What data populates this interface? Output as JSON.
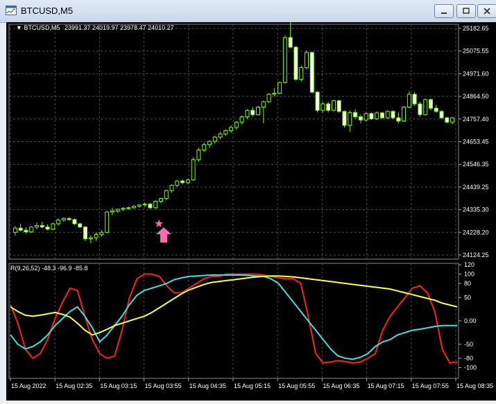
{
  "window": {
    "title": "BTCUSD,M5"
  },
  "info_line": {
    "symbol": "BTCUSD,M5",
    "ohlc": "23991.37 24019.97 23978.47 24010.27"
  },
  "price_axis": [
    "25182.65",
    "25075.55",
    "24971.60",
    "24864.50",
    "24757.40",
    "24653.45",
    "24546.35",
    "24439.25",
    "24335.30",
    "24228.20",
    "24124.25"
  ],
  "indicator": {
    "label": "R(9,26,52) -48.3 -96.9 -85.8",
    "axis": [
      "120",
      "100",
      "80",
      "50",
      "0.00",
      "-50",
      "-80",
      "-100"
    ]
  },
  "time_axis": [
    "15 Aug 2022",
    "15 Aug 02:35",
    "15 Aug 03:15",
    "15 Aug 03:55",
    "15 Aug 04:35",
    "15 Aug 05:15",
    "15 Aug 05:55",
    "15 Aug 06:35",
    "15 Aug 07:15",
    "15 Aug 07:55",
    "15 Aug 08:35"
  ],
  "colors": {
    "background": "#000000",
    "candle": "#7CFC00",
    "bull_body": "#000000",
    "bear_body": "#ffffff",
    "grid": "#4d4d4d",
    "arrow": "#ff69b4",
    "line_fast": "#ff2020",
    "line_mid": "#40e0e0",
    "line_slow": "#ffff40",
    "axis_text": "#ffffff"
  },
  "markers": {
    "star_icon": "star-icon",
    "arrow_icon": "up-arrow-icon"
  },
  "chart_data": {
    "type": "candlestick",
    "series": [
      {
        "name": "BTCUSD,M5",
        "ohlc": [
          [
            24230,
            24260,
            24215,
            24250
          ],
          [
            24250,
            24270,
            24235,
            24240
          ],
          [
            24240,
            24255,
            24225,
            24232
          ],
          [
            24232,
            24258,
            24228,
            24255
          ],
          [
            24255,
            24275,
            24245,
            24262
          ],
          [
            24262,
            24280,
            24250,
            24255
          ],
          [
            24255,
            24268,
            24240,
            24245
          ],
          [
            24245,
            24275,
            24240,
            24270
          ],
          [
            24270,
            24295,
            24262,
            24288
          ],
          [
            24288,
            24300,
            24280,
            24295
          ],
          [
            24295,
            24300,
            24285,
            24290
          ],
          [
            24290,
            24295,
            24265,
            24270
          ],
          [
            24270,
            24275,
            24250,
            24255
          ],
          [
            24255,
            24260,
            24190,
            24200
          ],
          [
            24200,
            24215,
            24180,
            24205
          ],
          [
            24205,
            24230,
            24190,
            24220
          ],
          [
            24220,
            24240,
            24210,
            24230
          ],
          [
            24230,
            24330,
            24225,
            24325
          ],
          [
            24325,
            24345,
            24310,
            24330
          ],
          [
            24330,
            24342,
            24322,
            24338
          ],
          [
            24338,
            24348,
            24330,
            24342
          ],
          [
            24342,
            24350,
            24335,
            24345
          ],
          [
            24345,
            24358,
            24340,
            24352
          ],
          [
            24352,
            24362,
            24345,
            24358
          ],
          [
            24358,
            24370,
            24350,
            24362
          ],
          [
            24362,
            24368,
            24340,
            24345
          ],
          [
            24345,
            24380,
            24340,
            24375
          ],
          [
            24375,
            24392,
            24365,
            24388
          ],
          [
            24388,
            24430,
            24380,
            24425
          ],
          [
            24425,
            24455,
            24415,
            24450
          ],
          [
            24450,
            24475,
            24440,
            24470
          ],
          [
            24470,
            24478,
            24455,
            24462
          ],
          [
            24462,
            24480,
            24455,
            24475
          ],
          [
            24475,
            24580,
            24470,
            24570
          ],
          [
            24570,
            24625,
            24560,
            24615
          ],
          [
            24615,
            24650,
            24605,
            24640
          ],
          [
            24640,
            24660,
            24625,
            24655
          ],
          [
            24655,
            24682,
            24645,
            24675
          ],
          [
            24675,
            24700,
            24665,
            24690
          ],
          [
            24690,
            24712,
            24680,
            24705
          ],
          [
            24705,
            24730,
            24695,
            24720
          ],
          [
            24720,
            24750,
            24710,
            24745
          ],
          [
            24745,
            24775,
            24735,
            24770
          ],
          [
            24770,
            24805,
            24760,
            24800
          ],
          [
            24800,
            24815,
            24770,
            24780
          ],
          [
            24780,
            24820,
            24775,
            24815
          ],
          [
            24815,
            24845,
            24740,
            24840
          ],
          [
            24840,
            24880,
            24835,
            24875
          ],
          [
            24875,
            24905,
            24865,
            24880
          ],
          [
            24880,
            24935,
            24875,
            24930
          ],
          [
            24930,
            25150,
            24925,
            25140
          ],
          [
            25140,
            25210,
            25090,
            25095
          ],
          [
            25095,
            25100,
            24940,
            24945
          ],
          [
            24945,
            25010,
            24935,
            25000
          ],
          [
            25000,
            25080,
            24990,
            25070
          ],
          [
            25070,
            25075,
            24880,
            24885
          ],
          [
            24885,
            24890,
            24790,
            24800
          ],
          [
            24800,
            24840,
            24790,
            24830
          ],
          [
            24830,
            24840,
            24790,
            24800
          ],
          [
            24800,
            24850,
            24795,
            24845
          ],
          [
            24845,
            24850,
            24790,
            24795
          ],
          [
            24795,
            24800,
            24720,
            24730
          ],
          [
            24730,
            24800,
            24700,
            24790
          ],
          [
            24790,
            24805,
            24760,
            24770
          ],
          [
            24770,
            24780,
            24740,
            24755
          ],
          [
            24755,
            24790,
            24748,
            24785
          ],
          [
            24785,
            24790,
            24755,
            24760
          ],
          [
            24760,
            24795,
            24755,
            24788
          ],
          [
            24788,
            24792,
            24760,
            24765
          ],
          [
            24765,
            24800,
            24760,
            24795
          ],
          [
            24795,
            24800,
            24760,
            24765
          ],
          [
            24765,
            24790,
            24740,
            24750
          ],
          [
            24750,
            24820,
            24745,
            24815
          ],
          [
            24815,
            24890,
            24810,
            24875
          ],
          [
            24875,
            24885,
            24820,
            24830
          ],
          [
            24830,
            24840,
            24770,
            24780
          ],
          [
            24780,
            24855,
            24775,
            24850
          ],
          [
            24850,
            24855,
            24800,
            24810
          ],
          [
            24810,
            24825,
            24790,
            24795
          ],
          [
            24795,
            24800,
            24760,
            24765
          ],
          [
            24765,
            24770,
            24740,
            24745
          ],
          [
            24745,
            24770,
            24735,
            24765
          ]
        ]
      }
    ],
    "price_range": [
      24124.25,
      25182.65
    ],
    "indicator_range": [
      -120,
      120
    ],
    "indicator_series": [
      {
        "name": "fast",
        "values": [
          35,
          -5,
          -60,
          -80,
          -70,
          -40,
          5,
          40,
          70,
          65,
          10,
          -40,
          -70,
          -80,
          -75,
          -20,
          50,
          90,
          100,
          100,
          95,
          75,
          60,
          60,
          70,
          80,
          90,
          95,
          95,
          100,
          100,
          100,
          100,
          100,
          98,
          95,
          92,
          90,
          90,
          80,
          10,
          -70,
          -90,
          -88,
          -85,
          -87,
          -90,
          -88,
          -80,
          -70,
          -20,
          10,
          30,
          50,
          70,
          75,
          60,
          20,
          -60,
          -90,
          -88
        ]
      },
      {
        "name": "mid",
        "values": [
          -30,
          -50,
          -60,
          -55,
          -45,
          -30,
          -10,
          5,
          20,
          30,
          10,
          -15,
          -45,
          -30,
          -10,
          10,
          35,
          55,
          65,
          70,
          75,
          80,
          88,
          92,
          95,
          96,
          97,
          98,
          98,
          98,
          98,
          98,
          97,
          96,
          95,
          90,
          80,
          60,
          40,
          20,
          0,
          -20,
          -40,
          -60,
          -75,
          -80,
          -82,
          -78,
          -70,
          -55,
          -45,
          -40,
          -30,
          -25,
          -20,
          -18,
          -15,
          -12,
          -10,
          -10,
          -10
        ]
      },
      {
        "name": "slow",
        "values": [
          30,
          20,
          12,
          10,
          12,
          15,
          18,
          14,
          8,
          -5,
          -20,
          -30,
          -25,
          -18,
          -10,
          -5,
          0,
          5,
          10,
          18,
          28,
          38,
          48,
          58,
          66,
          72,
          78,
          82,
          84,
          86,
          88,
          90,
          92,
          94,
          95,
          96,
          96,
          95,
          94,
          92,
          90,
          88,
          86,
          84,
          82,
          80,
          78,
          76,
          74,
          72,
          70,
          68,
          64,
          60,
          56,
          52,
          48,
          44,
          38,
          34,
          30
        ]
      }
    ]
  }
}
